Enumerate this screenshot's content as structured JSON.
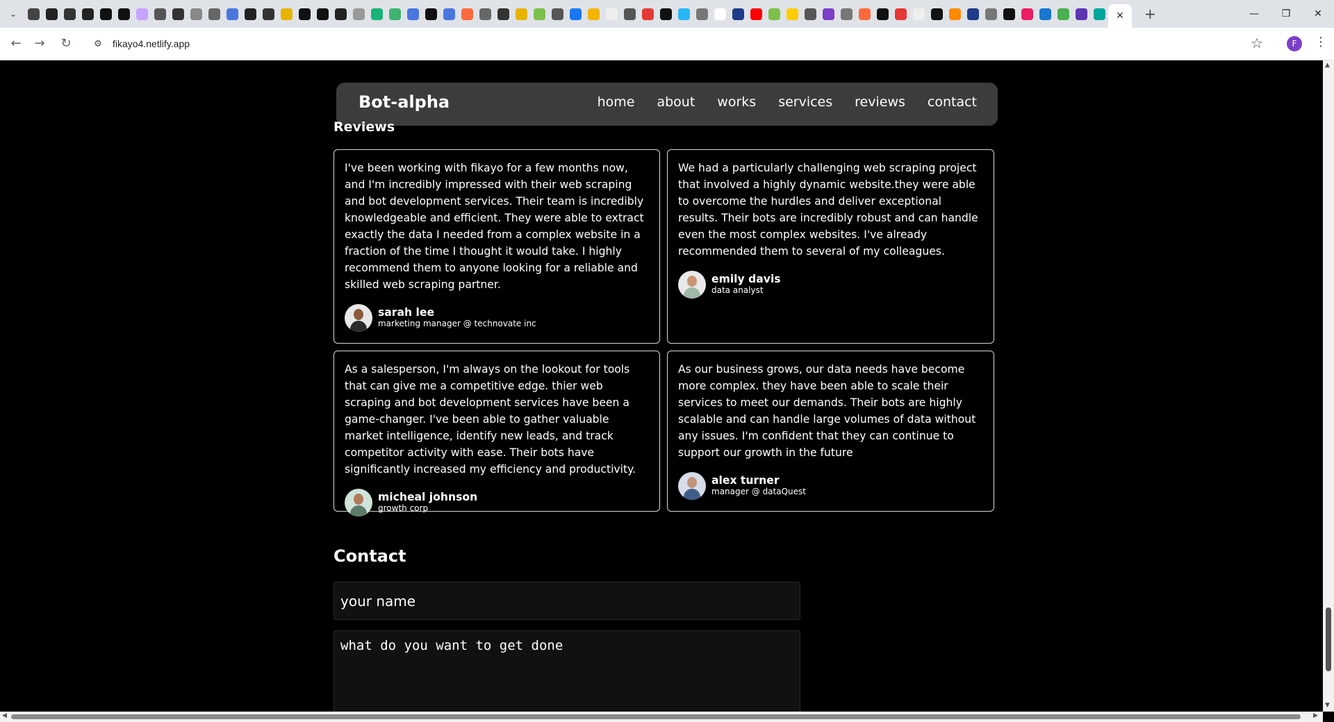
{
  "browser": {
    "url": "fikayo4.netlify.app",
    "profile_initial": "F",
    "favicon_colors": [
      "#444",
      "#222",
      "#333",
      "#222",
      "#111",
      "#111",
      "#c8a2ff",
      "#555",
      "#333",
      "#888",
      "#666",
      "#4a76e0",
      "#222",
      "#333",
      "#e8b300",
      "#111",
      "#111",
      "#222",
      "#999",
      "#19b37a",
      "#3cb371",
      "#4a76e0",
      "#111",
      "#4a76e0",
      "#ff6a3d",
      "#666",
      "#333",
      "#e8b300",
      "#7cc04b",
      "#555",
      "#1877f2",
      "#f5b400",
      "#eee",
      "#555",
      "#e53935",
      "#111",
      "#29b6f6",
      "#777",
      "#fff",
      "#1e3a8a",
      "#ff0000",
      "#7cc04b",
      "#ffcc00",
      "#555",
      "#7b3fc9",
      "#777",
      "#ff6a3d",
      "#111",
      "#e53935",
      "#eee",
      "#111",
      "#ff8a00",
      "#1e3a8a",
      "#777",
      "#111",
      "#e91e63",
      "#1976d2",
      "#4caf50",
      "#5e35b1",
      "#00a59b"
    ]
  },
  "nav": {
    "brand": "Bot-alpha",
    "links": [
      "home",
      "about",
      "works",
      "services",
      "reviews",
      "contact"
    ]
  },
  "reviews": {
    "title": "Reviews",
    "items": [
      {
        "text": "I've been working with fikayo for a few months now, and I'm incredibly impressed with their web scraping and bot development services. Their team is incredibly knowledgeable and efficient. They were able to extract exactly the data I needed from a complex website in a fraction of the time I thought it would take. I highly recommend them to anyone looking for a reliable and skilled web scraping partner.",
        "name": "sarah lee",
        "role": "marketing manager @ technovate inc"
      },
      {
        "text": "We had a particularly challenging web scraping project that involved a highly dynamic website.they were able to overcome the hurdles and deliver exceptional results. Their bots are incredibly robust and can handle even the most complex websites. I've already recommended them to several of my colleagues.",
        "name": "emily davis",
        "role": "data analyst"
      },
      {
        "text": "As a salesperson, I'm always on the lookout for tools that can give me a competitive edge. thier web scraping and bot development services have been a game-changer. I've been able to gather valuable market intelligence, identify new leads, and track competitor activity with ease. Their bots have significantly increased my efficiency and productivity.",
        "name": "micheal johnson",
        "role": "growth corp"
      },
      {
        "text": "As our business grows, our data needs have become more complex. they have been able to scale their services to meet our demands. Their bots are highly scalable and can handle large volumes of data without any issues. I'm confident that they can continue to support our growth in the future",
        "name": "alex turner",
        "role": "manager @ dataQuest"
      }
    ]
  },
  "contact": {
    "title": "Contact",
    "name_placeholder": "your name",
    "message_placeholder": "what do you want to get done"
  }
}
